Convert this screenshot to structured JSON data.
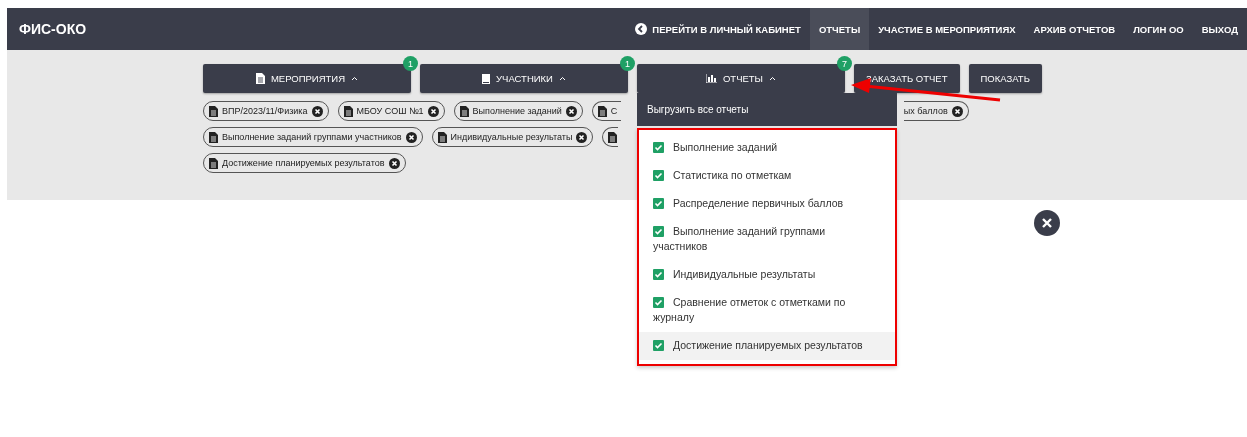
{
  "header": {
    "logo": "ФИС-ОКО",
    "nav": [
      {
        "label": "ПЕРЕЙТИ В ЛИЧНЫЙ КАБИНЕТ",
        "kind": "back",
        "selected": false
      },
      {
        "label": "ОТЧЕТЫ",
        "kind": "link",
        "selected": true
      },
      {
        "label": "УЧАСТИЕ В МЕРОПРИЯТИЯХ",
        "kind": "link",
        "selected": false
      },
      {
        "label": "АРХИВ ОТЧЕТОВ",
        "kind": "link",
        "selected": false
      },
      {
        "label": "ЛОГИН ОО",
        "kind": "link",
        "selected": false
      },
      {
        "label": "ВЫХОД",
        "kind": "link",
        "selected": false
      }
    ]
  },
  "toolbar": [
    {
      "label": "МЕРОПРИЯТИЯ",
      "kind": "dropdown",
      "badge": "1"
    },
    {
      "label": "УЧАСТНИКИ",
      "kind": "dropdown",
      "badge": "1"
    },
    {
      "label": "ОТЧЕТЫ",
      "kind": "dropdown",
      "badge": "7"
    },
    {
      "label": "ЗАКАЗАТЬ ОТЧЕТ",
      "kind": "action"
    },
    {
      "label": "ПОКАЗАТЬ",
      "kind": "action"
    }
  ],
  "chip_rows": [
    [
      {
        "label": "ВПР/2023/11/Физика",
        "kind": "full"
      },
      {
        "label": "МБОУ СОШ №1",
        "kind": "full"
      },
      {
        "label": "Выполнение заданий",
        "kind": "full"
      },
      {
        "label": "С",
        "kind": "cut_right"
      },
      {
        "label": "ых баллов",
        "kind": "cut_left"
      }
    ],
    [
      {
        "label": "Выполнение заданий группами участников",
        "kind": "full"
      },
      {
        "label": "Индивидуальные результаты",
        "kind": "full"
      },
      {
        "kind": "cut_right"
      }
    ],
    [
      {
        "label": "Достижение планируемых результатов",
        "kind": "full"
      }
    ]
  ],
  "reports_menu": {
    "export_all": "Выгрузить все отчеты",
    "items": [
      {
        "label": "Выполнение заданий",
        "checked": true,
        "highlighted": false
      },
      {
        "label": "Статистика по отметкам",
        "checked": true,
        "highlighted": false
      },
      {
        "label": "Распределение первичных баллов",
        "checked": true,
        "highlighted": false
      },
      {
        "label": "Выполнение заданий группами участников",
        "checked": true,
        "highlighted": false
      },
      {
        "label": "Индивидуальные результаты",
        "checked": true,
        "highlighted": false
      },
      {
        "label": "Сравнение отметок с отметками по журналу",
        "checked": true,
        "highlighted": false
      },
      {
        "label": "Достижение планируемых результатов",
        "checked": true,
        "highlighted": true
      }
    ]
  }
}
